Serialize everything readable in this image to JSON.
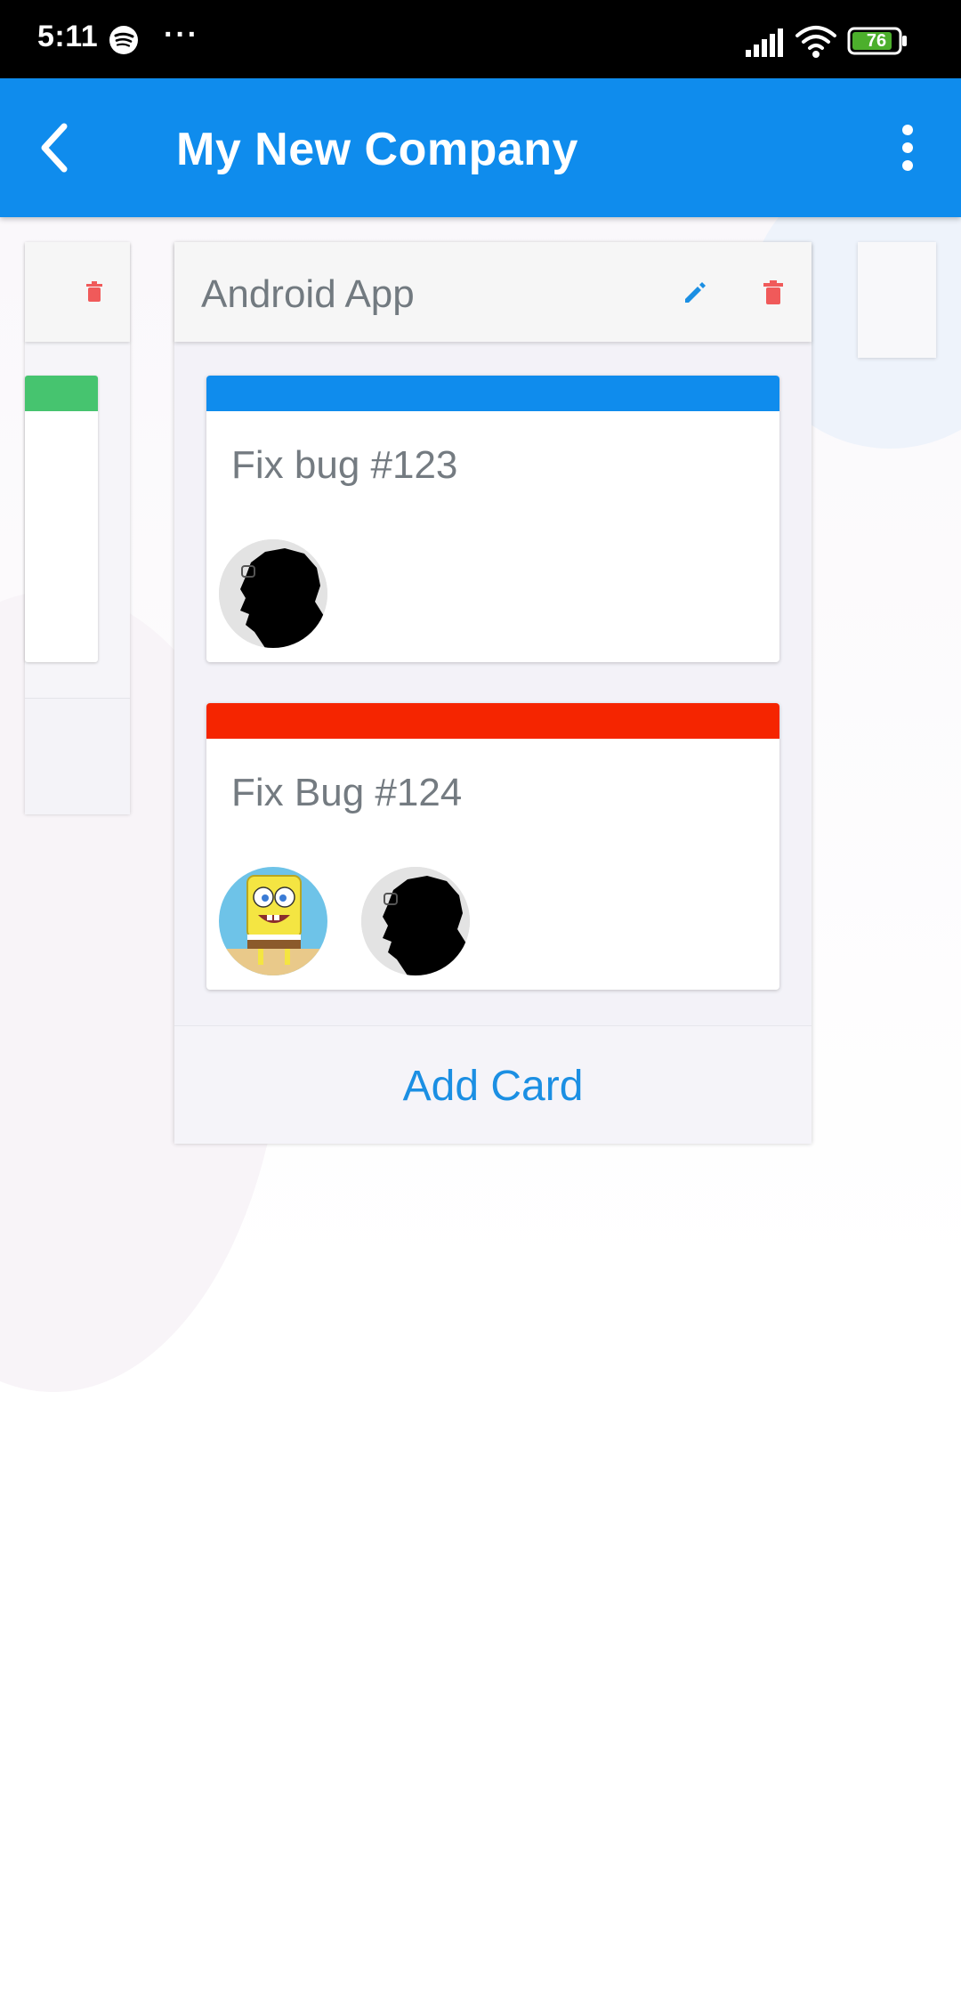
{
  "status_bar": {
    "time": "5:11",
    "more": "···",
    "battery": "76",
    "icons": [
      "spotify-icon",
      "signal-icon",
      "wifi-icon",
      "battery-icon"
    ]
  },
  "app_bar": {
    "title": "My New Company",
    "back_icon": "back-arrow-icon",
    "menu_icon": "overflow-menu-icon"
  },
  "colors": {
    "app_bar": "#0f8ced",
    "green_label": "#46c46f",
    "blue_label": "#0f8ced",
    "red_label": "#f52500",
    "delete_icon": "#f05a5a",
    "edit_icon": "#1b8fe3",
    "add_card_text": "#1b8fe3"
  },
  "board": {
    "list": {
      "title": "Android App",
      "cards": [
        {
          "title": "Fix bug #123",
          "label_color": "#0f8ced",
          "members": [
            "silhouette-avatar"
          ]
        },
        {
          "title": "Fix Bug #124",
          "label_color": "#f52500",
          "members": [
            "cartoon-avatar",
            "silhouette-avatar"
          ]
        }
      ],
      "add_card_label": "Add Card"
    }
  }
}
